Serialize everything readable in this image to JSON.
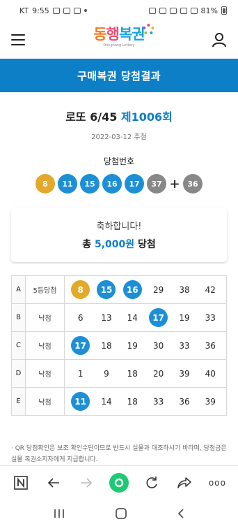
{
  "status_bar": {
    "carrier": "KT",
    "time": "9:55",
    "battery": "81%"
  },
  "header": {
    "logo_text_1": "동",
    "logo_text_2": "행",
    "logo_text_3": "복권",
    "logo_sub": "Donghang Lottery"
  },
  "page_title": "구매복권 당첨결과",
  "draw": {
    "game": "로또 6/45",
    "round": "제1006회",
    "date": "2022-03-12 추첨",
    "winning_label": "당첨번호",
    "numbers": [
      8,
      11,
      15,
      16,
      17,
      37
    ],
    "bonus_symbol": "+",
    "bonus": 36
  },
  "congrats": {
    "message": "축하합니다!",
    "prefix": "총",
    "amount": "5,000원",
    "suffix": "당첨"
  },
  "tickets": [
    {
      "label": "A",
      "result": "5등당첨",
      "numbers": [
        8,
        15,
        16,
        29,
        38,
        42
      ]
    },
    {
      "label": "B",
      "result": "낙첨",
      "numbers": [
        6,
        13,
        14,
        17,
        19,
        33
      ]
    },
    {
      "label": "C",
      "result": "낙첨",
      "numbers": [
        17,
        18,
        19,
        30,
        33,
        36
      ]
    },
    {
      "label": "D",
      "result": "낙첨",
      "numbers": [
        1,
        9,
        18,
        20,
        39,
        40
      ]
    },
    {
      "label": "E",
      "result": "낙첨",
      "numbers": [
        11,
        14,
        18,
        33,
        36,
        39
      ]
    }
  ],
  "notice": "· QR 당첨확인은 보조 확인수단이므로 반드시 실물과 대조하시기 바라며, 당첨금은 실물 복권소지자에게 지급합니다.",
  "browser_bar": {
    "icons": [
      "n-icon",
      "back-arrow-icon",
      "forward-arrow-icon",
      "home-circle-icon",
      "refresh-icon",
      "share-icon",
      "more-icon"
    ],
    "more_label": "ooo"
  },
  "nav_bar": {
    "icons": [
      "recent-apps-icon",
      "home-icon",
      "back-icon"
    ]
  },
  "colors": {
    "primary": "#0c7fc7",
    "ball_yellow": "#e4a92a",
    "ball_blue": "#1c8fd6",
    "ball_gray": "#888888"
  }
}
